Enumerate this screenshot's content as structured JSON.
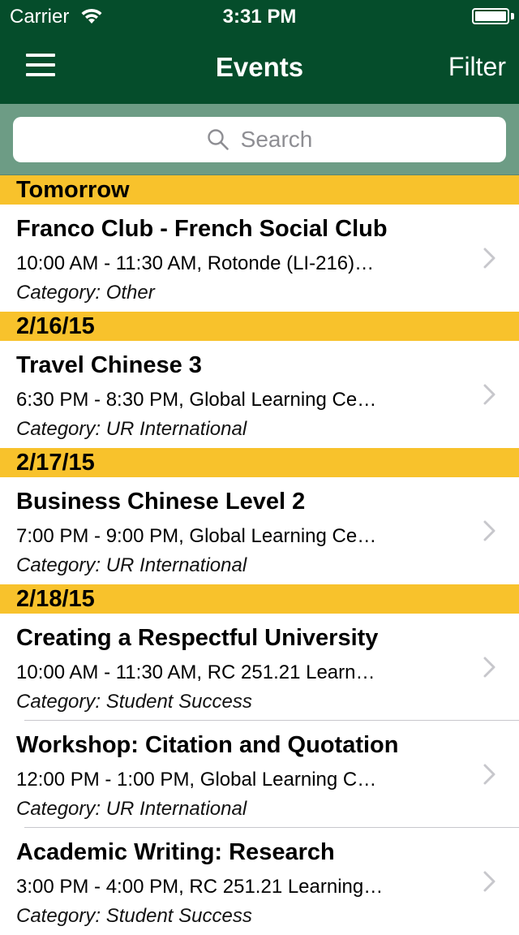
{
  "status_bar": {
    "carrier": "Carrier",
    "time": "3:31 PM",
    "battery_level": 1.0
  },
  "nav": {
    "title": "Events",
    "filter_label": "Filter",
    "menu_icon": "hamburger-menu-icon"
  },
  "search": {
    "placeholder": "Search",
    "icon": "search-icon"
  },
  "colors": {
    "nav_background": "#054d2b",
    "search_background": "#6d9c85",
    "section_header": "#f8c22c"
  },
  "sections": [
    {
      "header": "Tomorrow",
      "events": [
        {
          "title": "Franco Club - French Social Club",
          "detail": "10:00 AM - 11:30 AM, Rotonde (LI-216)…",
          "category": "Category: Other"
        }
      ]
    },
    {
      "header": "2/16/15",
      "events": [
        {
          "title": "Travel Chinese 3",
          "detail": "6:30 PM - 8:30 PM, Global Learning Ce…",
          "category": "Category: UR International"
        }
      ]
    },
    {
      "header": "2/17/15",
      "events": [
        {
          "title": "Business Chinese Level 2",
          "detail": "7:00 PM - 9:00 PM, Global Learning Ce…",
          "category": "Category: UR International"
        }
      ]
    },
    {
      "header": "2/18/15",
      "events": [
        {
          "title": "Creating a Respectful University",
          "detail": "10:00 AM - 11:30 AM, RC 251.21  Learn…",
          "category": "Category: Student Success"
        },
        {
          "title": "Workshop: Citation and Quotation",
          "detail": "12:00 PM - 1:00 PM, Global Learning C…",
          "category": "Category: UR International"
        },
        {
          "title": "Academic Writing:  Research",
          "detail": "3:00 PM - 4:00 PM, RC 251.21 Learning…",
          "category": "Category: Student Success"
        }
      ]
    }
  ]
}
